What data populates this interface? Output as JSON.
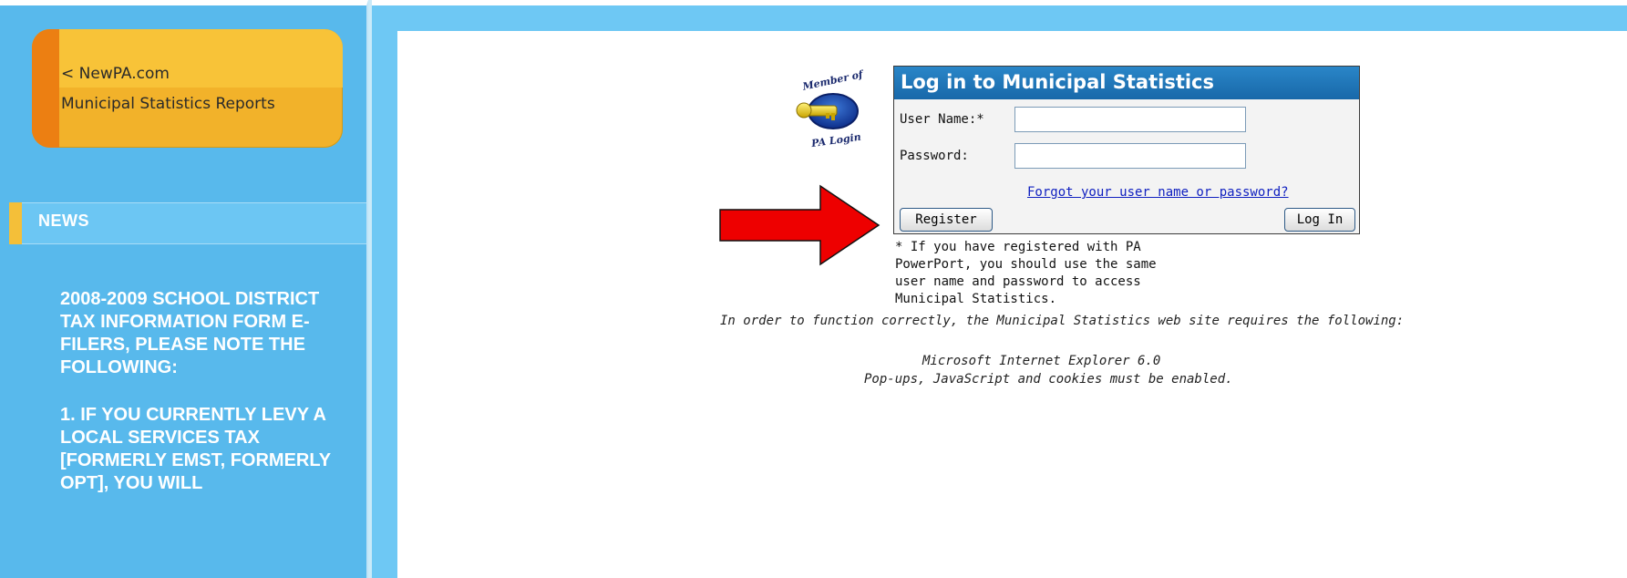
{
  "sidebar": {
    "nav": {
      "newpa_link": "< NewPA.com",
      "reports_link": "Municipal Statistics Reports"
    },
    "news": {
      "title": "NEWS",
      "paragraphs": [
        "2008-2009 SCHOOL DISTRICT TAX INFORMATION FORM E-FILERS, PLEASE NOTE THE FOLLOWING:",
        "1.  IF YOU CURRENTLY LEVY A LOCAL SERVICES TAX [FORMERLY EMST, FORMERLY OPT], YOU WILL"
      ]
    }
  },
  "logo": {
    "top_text": "Member of",
    "bottom_text": "PA Login",
    "icon": "key-badge-icon"
  },
  "login": {
    "title": "Log in to Municipal Statistics",
    "username_label": "User Name:*",
    "password_label": "Password:",
    "username_value": "",
    "password_value": "",
    "forgot_link": "Forgot your user name or password?",
    "register_button": "Register",
    "login_button": "Log In",
    "note": "* If you have registered with PA PowerPort, you should use the same user name and password to access Municipal Statistics."
  },
  "requirements": {
    "intro": "In order to function correctly, the Municipal Statistics web site requires the following:",
    "browser": "Microsoft Internet Explorer 6.0",
    "enable": "Pop-ups, JavaScript and cookies must be enabled."
  },
  "colors": {
    "sidebar": "#58b9ec",
    "nav_orange": "#f2b22a",
    "login_header": "#1f74b8",
    "arrow": "#ee0000"
  }
}
